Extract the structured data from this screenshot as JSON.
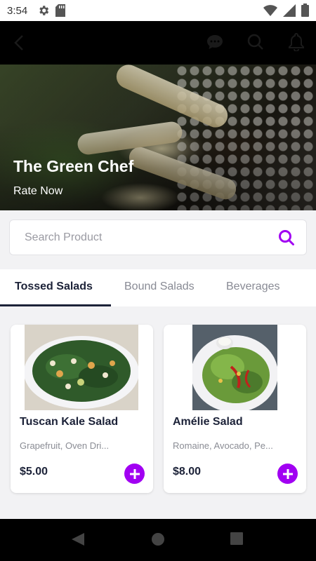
{
  "status_bar": {
    "time": "3:54",
    "left_icons": [
      "gear-icon",
      "sd-card-icon"
    ],
    "right_icons": [
      "wifi-icon",
      "cell-signal-icon",
      "battery-icon"
    ]
  },
  "app_bar": {
    "icons": [
      "back-arrow-icon",
      "chat-icon",
      "search-icon",
      "bell-icon"
    ]
  },
  "hero": {
    "title": "The Green Chef",
    "rate_link": "Rate Now"
  },
  "search": {
    "placeholder": "Search Product",
    "value": ""
  },
  "tabs": [
    {
      "label": "Tossed Salads",
      "active": true
    },
    {
      "label": "Bound Salads",
      "active": false
    },
    {
      "label": "Beverages",
      "active": false
    }
  ],
  "products": [
    {
      "name": "Tuscan Kale Salad",
      "description": "Grapefruit, Oven Dri...",
      "price": "$5.00"
    },
    {
      "name": "Amélie Salad",
      "description": "Romaine, Avocado, Pe...",
      "price": "$8.00"
    }
  ],
  "colors": {
    "accent": "#a100f2",
    "text_dark": "#1c2238",
    "text_muted": "#8a8c94",
    "bar_black": "#000000"
  },
  "nav_bar": {
    "icons": [
      "back-triangle-icon",
      "home-circle-icon",
      "recents-square-icon"
    ]
  }
}
